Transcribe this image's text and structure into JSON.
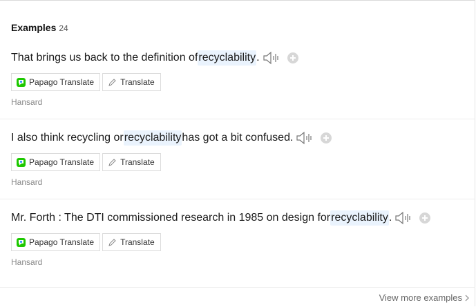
{
  "section": {
    "title": "Examples",
    "count": "24"
  },
  "examples": [
    {
      "before": "That brings us back to the definition of ",
      "highlight": "recyclability",
      "after": ".",
      "papago_label": "Papago Translate",
      "translate_label": "Translate",
      "source": "Hansard"
    },
    {
      "before": "I also think recycling or ",
      "highlight": "recyclability",
      "after": " has got a bit confused.",
      "papago_label": "Papago Translate",
      "translate_label": "Translate",
      "source": "Hansard"
    },
    {
      "before": "Mr. Forth : The DTI commissioned research in 1985 on design for ",
      "highlight": "recyclability",
      "after": ".",
      "papago_label": "Papago Translate",
      "translate_label": "Translate",
      "source": "Hansard"
    }
  ],
  "footer": {
    "more_label": "View more examples"
  },
  "colors": {
    "highlight_bg": "#eaf3fd",
    "papago_green": "#1ec800",
    "papago_blue": "#1a8cff"
  }
}
